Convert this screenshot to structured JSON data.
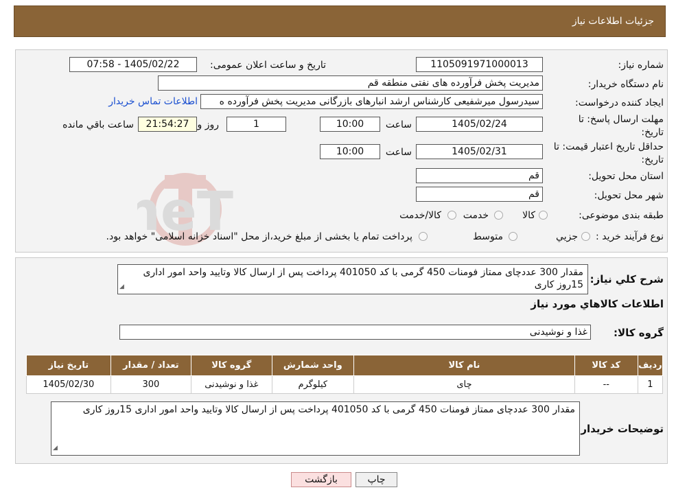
{
  "header": {
    "title": "جزئیات اطلاعات نیاز"
  },
  "form": {
    "need_number_label": "شماره نیاز:",
    "need_number": "1105091971000013",
    "announce_label": "تاریخ و ساعت اعلان عمومی:",
    "announce_value": "1405/02/22 - 07:58",
    "buyer_label": "نام دستگاه خریدار:",
    "buyer_value": "مدیریت پخش فرآورده های نفتی منطقه قم",
    "creator_label": "ایجاد کننده درخواست:",
    "creator_value": "سیدرسول میرشفیعی کارشناس ارشد انبارهای بازرگانی مدیریت پخش فرآورده ه",
    "contact_link": "اطلاعات تماس خریدار",
    "deadline_label_1": "مهلت ارسال پاسخ: تا",
    "deadline_label_2": "تاریخ:",
    "deadline_date": "1405/02/24",
    "time_label": "ساعت",
    "deadline_time": "10:00",
    "days_value": "1",
    "days_label": "روز و",
    "remaining_time": "21:54:27",
    "remaining_label": "ساعت باقي مانده",
    "validity_label_1": "حداقل تاریخ اعتبار قیمت: تا",
    "validity_label_2": "تاریخ:",
    "validity_date": "1405/02/31",
    "validity_time": "10:00",
    "province_label": "استان محل تحویل:",
    "province_value": "قم",
    "city_label": "شهر محل تحویل:",
    "city_value": "قم",
    "category_label": "طبقه بندی موضوعی:",
    "category_options": [
      "کالا",
      "خدمت",
      "کالا/خدمت"
    ],
    "process_label": "نوع فرآیند خرید :",
    "process_options": [
      "جزيي",
      "متوسط"
    ],
    "process_note": "پرداخت تمام یا بخشی از مبلغ خرید،از محل \"اسناد خزانه اسلامی\" خواهد بود."
  },
  "description": {
    "label": "شرح کلي نياز:",
    "text": "مقدار 300 عددچای ممتاز فومنات 450 گرمی با کد 401050 پرداخت پس از ارسال کالا وتایید واحد امور اداری 15روز کاری",
    "items_title": "اطلاعات کالاهاي مورد نياز",
    "group_label": "گروه کالا:",
    "group_value": "غذا و نوشیدنی"
  },
  "table": {
    "headers": [
      "رديف",
      "کد کالا",
      "نام کالا",
      "واحد شمارش",
      "گروه کالا",
      "تعداد / مقدار",
      "تاریخ نیاز"
    ],
    "rows": [
      [
        "1",
        "--",
        "چای",
        "کیلوگرم",
        "غذا و نوشیدنی",
        "300",
        "1405/02/30"
      ]
    ]
  },
  "buyer_notes": {
    "label": "توضیحات خریدار:",
    "text": "مقدار 300 عددچای ممتاز فومنات 450 گرمی با کد 401050 پرداخت پس از ارسال کالا وتایید واحد امور اداری 15روز کاری"
  },
  "buttons": {
    "print": "چاپ",
    "back": "بازگشت"
  },
  "watermark_text": "AriaTender.neT"
}
